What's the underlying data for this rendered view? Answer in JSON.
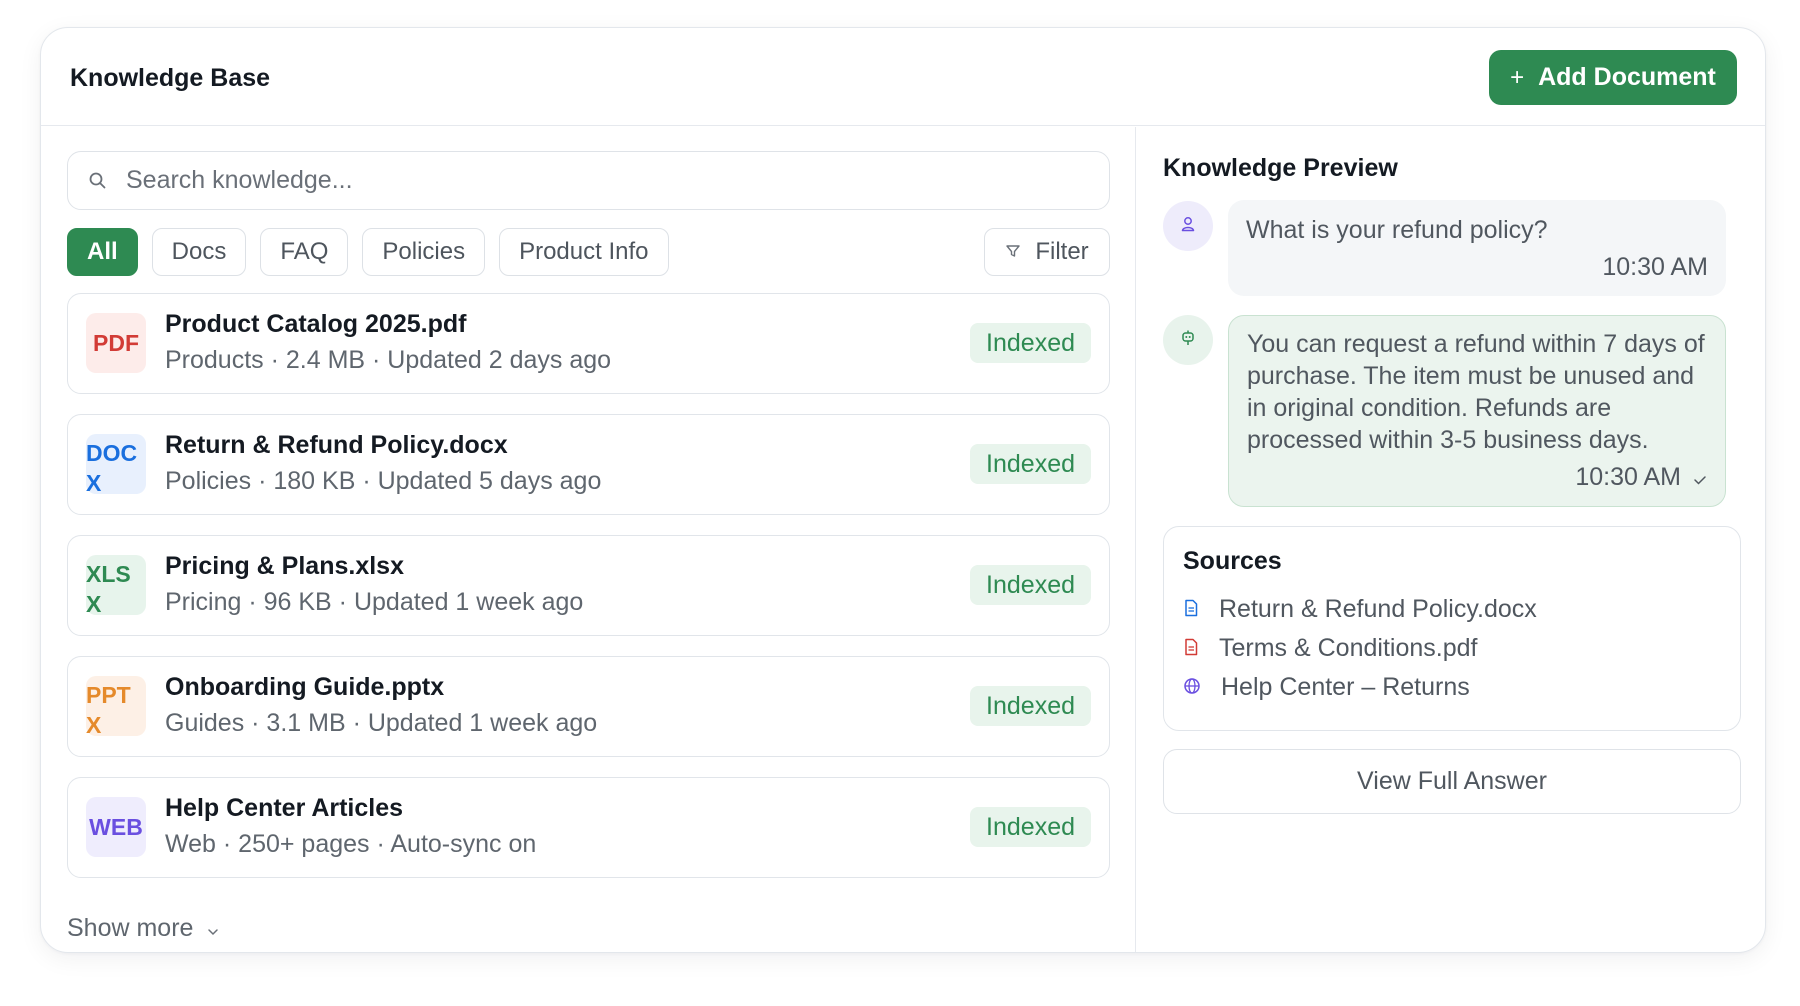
{
  "header": {
    "title": "Knowledge Base",
    "add_button": "Add Document",
    "add_icon": "plus-icon"
  },
  "search": {
    "placeholder": "Search knowledge..."
  },
  "filters": {
    "chips": [
      "All",
      "Docs",
      "FAQ",
      "Policies",
      "Product Info"
    ],
    "active": "All",
    "filter_label": "Filter"
  },
  "documents": [
    {
      "badge": "PDF",
      "name": "Product Catalog 2025.pdf",
      "meta": "Products · 2.4 MB · Updated 2 days ago",
      "status": "Indexed"
    },
    {
      "badge": "DOCX",
      "name": "Return & Refund Policy.docx",
      "meta": "Policies · 180 KB · Updated 5 days ago",
      "status": "Indexed"
    },
    {
      "badge": "XLSX",
      "name": "Pricing & Plans.xlsx",
      "meta": "Pricing · 96 KB · Updated 1 week ago",
      "status": "Indexed"
    },
    {
      "badge": "PPTX",
      "name": "Onboarding Guide.pptx",
      "meta": "Guides · 3.1 MB · Updated 1 week ago",
      "status": "Indexed"
    },
    {
      "badge": "WEB",
      "name": "Help Center Articles",
      "meta": "Web · 250+ pages · Auto-sync on",
      "status": "Indexed"
    }
  ],
  "show_more": "Show more",
  "preview": {
    "title": "Knowledge Preview",
    "question": {
      "text": "What is your refund policy?",
      "time": "10:30 AM"
    },
    "answer": {
      "text": "You can request a refund within 7 days of purchase. The item must be unused and in original condition. Refunds are processed within 3-5 business days.",
      "time": "10:30 AM"
    }
  },
  "sources": {
    "title": "Sources",
    "items": [
      {
        "label": "Return & Refund Policy.docx",
        "icon": "document-icon"
      },
      {
        "label": "Terms & Conditions.pdf",
        "icon": "pdf-icon"
      },
      {
        "label": "Help Center – Returns",
        "icon": "globe-icon"
      }
    ]
  },
  "view_full": "View Full Answer",
  "colors": {
    "accent": "#2e8a52",
    "pdf": "#d23b36",
    "doc": "#1a6fde",
    "xls": "#2e8a52",
    "ppt": "#e58a2b",
    "web": "#6a4fe0"
  }
}
